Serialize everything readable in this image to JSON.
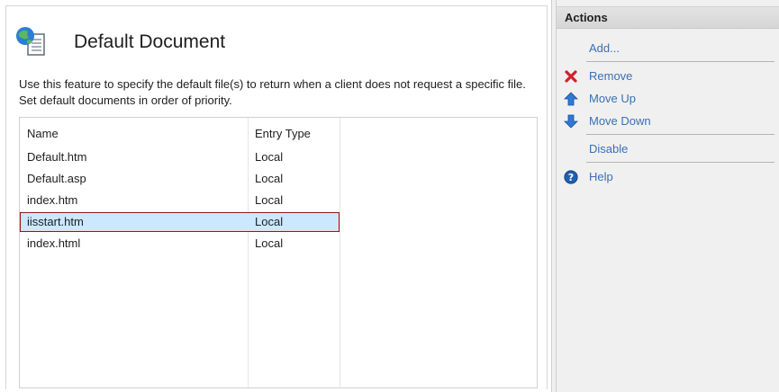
{
  "feature": {
    "title": "Default Document",
    "description": "Use this feature to specify the default file(s) to return when a client does not request a specific file. Set default documents in order of priority.",
    "icon": "globe-document-icon"
  },
  "list": {
    "columns": [
      "Name",
      "Entry Type"
    ],
    "rows": [
      {
        "name": "Default.htm",
        "type": "Local"
      },
      {
        "name": "Default.asp",
        "type": "Local"
      },
      {
        "name": "index.htm",
        "type": "Local"
      },
      {
        "name": "iisstart.htm",
        "type": "Local"
      },
      {
        "name": "index.html",
        "type": "Local"
      }
    ],
    "selected_row": "iisstart.htm"
  },
  "actions": {
    "header": "Actions",
    "items": [
      {
        "label": "Add...",
        "icon": "none"
      },
      {
        "label": "Remove",
        "icon": "red-x-icon"
      },
      {
        "label": "Move Up",
        "icon": "blue-up-arrow-icon"
      },
      {
        "label": "Move Down",
        "icon": "blue-down-arrow-icon"
      },
      {
        "label": "Disable",
        "icon": "none"
      },
      {
        "label": "Help",
        "icon": "help-icon"
      }
    ]
  },
  "colors": {
    "link": "#3a6fb5",
    "selection": "#cce8ff",
    "selection_border": "#8b1a1a"
  }
}
